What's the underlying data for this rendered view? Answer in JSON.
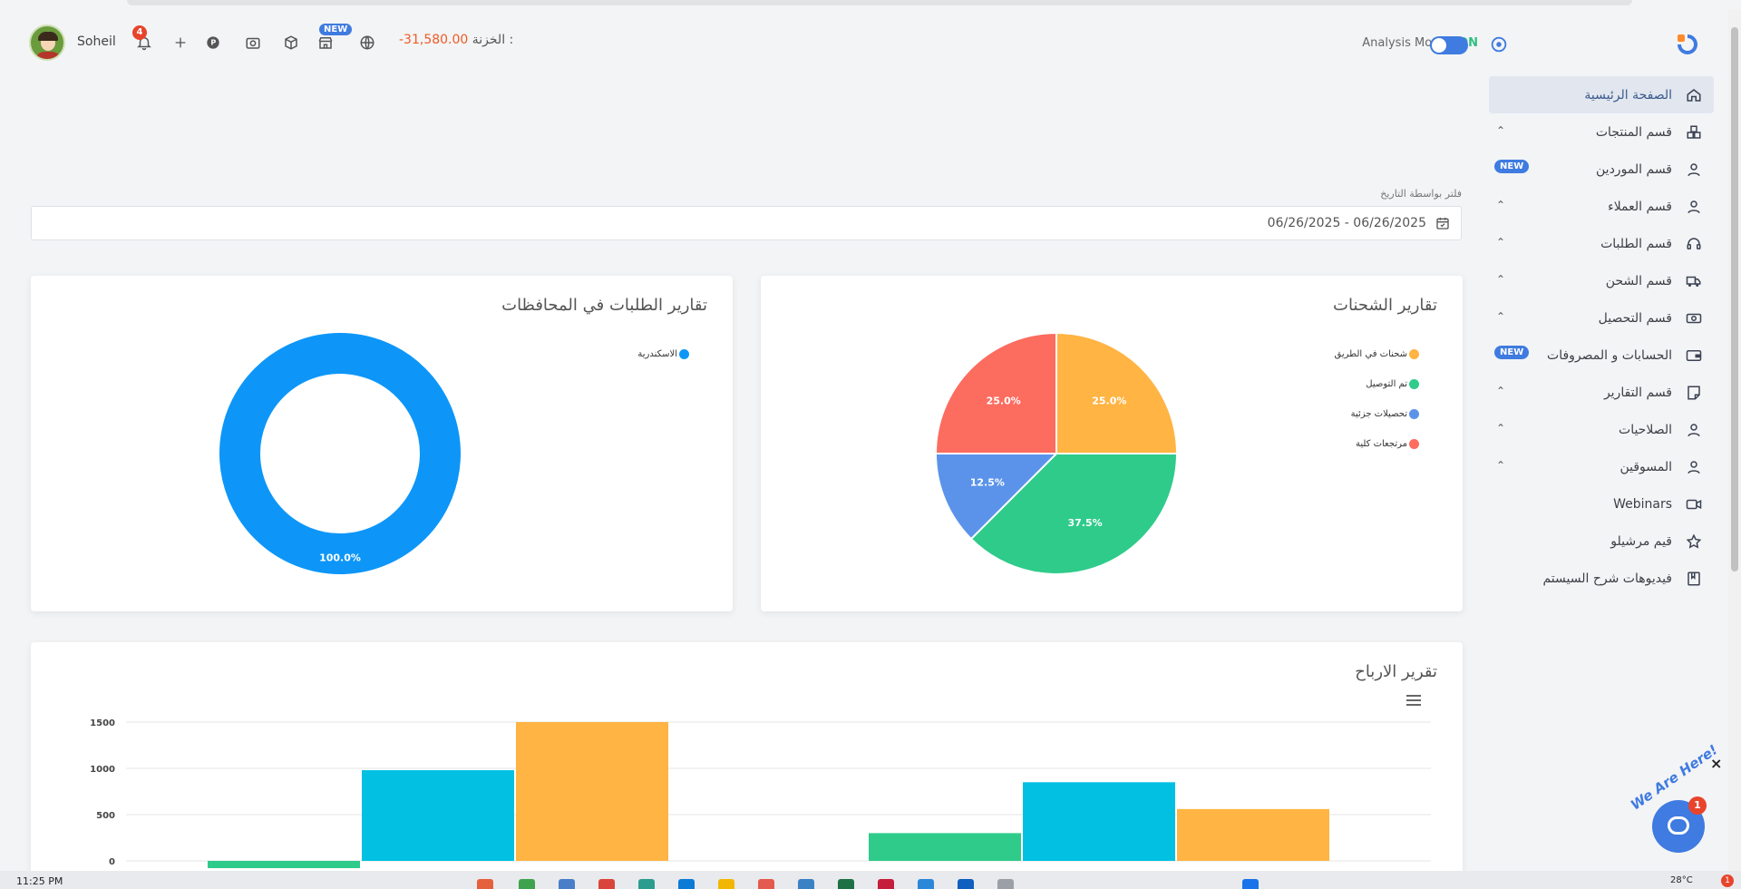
{
  "header": {
    "username": "Soheil",
    "notifications_count": "4",
    "new_badge": "NEW",
    "treasury_value": "-31,580.00",
    "treasury_label": "الخزنة :",
    "analysis_label": "Analysis Mode :",
    "analysis_state": "ON"
  },
  "sidebar": {
    "items": [
      {
        "label": "الصفحة الرئيسية",
        "icon": "home-icon",
        "active": true
      },
      {
        "label": "قسم المنتجات",
        "icon": "boxes-icon",
        "expandable": true
      },
      {
        "label": "قسم الموردين",
        "icon": "user-icon",
        "badge": "NEW"
      },
      {
        "label": "قسم العملاء",
        "icon": "user-icon",
        "expandable": true
      },
      {
        "label": "قسم الطلبات",
        "icon": "headset-icon",
        "expandable": true
      },
      {
        "label": "قسم الشحن",
        "icon": "truck-icon",
        "expandable": true
      },
      {
        "label": "قسم التحصيل",
        "icon": "cash-icon",
        "expandable": true
      },
      {
        "label": "الحسابات و المصروفات",
        "icon": "wallet-icon",
        "badge": "NEW"
      },
      {
        "label": "قسم التقارير",
        "icon": "report-icon",
        "expandable": true
      },
      {
        "label": "الصلاحيات",
        "icon": "user-icon",
        "expandable": true
      },
      {
        "label": "المسوقين",
        "icon": "user-icon",
        "expandable": true
      },
      {
        "label": "Webinars",
        "icon": "video-icon"
      },
      {
        "label": "قيم مرشيلو",
        "icon": "star-icon"
      },
      {
        "label": "فيديوهات شرح السيستم",
        "icon": "book-icon"
      }
    ]
  },
  "filter": {
    "label": "فلتر بواسطة التاريخ",
    "value": "06/26/2025 - 06/26/2025"
  },
  "shipments_card": {
    "title": "تقارير الشحنات"
  },
  "governorates_card": {
    "title": "تقارير الطلبات في المحافظات"
  },
  "profits_card": {
    "title": "تقرير الارباح"
  },
  "chart_data": [
    {
      "type": "pie",
      "title": "تقارير الشحنات",
      "labels": [
        "شحنات في الطريق",
        "تم التوصيل",
        "تحصيلات جزئية",
        "مرتجعات كلية"
      ],
      "values": [
        25.0,
        37.5,
        12.5,
        25.0
      ],
      "value_labels": [
        "25.0%",
        "37.5%",
        "12.5%",
        "25.0%"
      ],
      "colors": [
        "#ffb443",
        "#2fcb8b",
        "#5b93ea",
        "#fc6c5f"
      ],
      "legend": "top-right"
    },
    {
      "type": "pie",
      "title": "تقارير الطلبات في المحافظات",
      "labels": [
        "الاسكندرية"
      ],
      "values": [
        100.0
      ],
      "value_labels": [
        "100.0%"
      ],
      "colors": [
        "#0d96f8"
      ],
      "legend": "top-right"
    },
    {
      "type": "bar",
      "title": "تقرير الارباح",
      "categories": [
        "",
        ""
      ],
      "series": [
        {
          "values": [
            -20,
            300
          ],
          "color": "#2fcb8b"
        },
        {
          "values": [
            980,
            850
          ],
          "color": "#01c0e2"
        },
        {
          "values": [
            1500,
            560
          ],
          "color": "#ffb443"
        }
      ],
      "yticks": [
        "0",
        "500",
        "1000",
        "1500"
      ],
      "ylim": [
        0,
        1500
      ]
    }
  ],
  "chat": {
    "tagline": "We Are Here!",
    "notif_count": "1",
    "close": "×"
  },
  "taskbar": {
    "clock": "11:25 PM",
    "temperature": "28°C",
    "notif": "1"
  }
}
